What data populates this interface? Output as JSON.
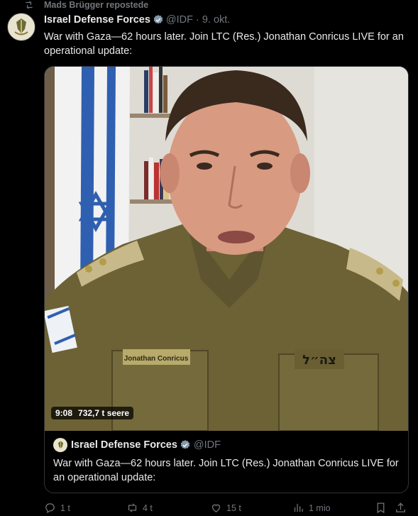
{
  "repost_header": {
    "icon": "repost-icon",
    "text": "Mads Brügger repostede"
  },
  "tweet": {
    "author_name": "Israel Defense Forces",
    "handle": "@IDF",
    "separator": "·",
    "date": "9. okt.",
    "verified_icon": "verified-badge-icon",
    "text": "War with Gaza—62 hours later. Join LTC (Res.) Jonathan Conricus LIVE for an operational update:"
  },
  "video": {
    "duration": "9:08",
    "views": "732,7 t seere",
    "name_tape": "Jonathan Conricus",
    "unit_tape": "צה״ל"
  },
  "quoted_tweet": {
    "author_name": "Israel Defense Forces",
    "handle": "@IDF",
    "text": "War with Gaza—62 hours later. Join LTC (Res.) Jonathan Conricus LIVE for an operational update:"
  },
  "actions": {
    "replies": "1 t",
    "reposts": "4 t",
    "likes": "15 t",
    "views": "1 mio"
  },
  "colors": {
    "background": "#000000",
    "text": "#e7e9ea",
    "muted": "#71767b",
    "verified": "#829aab",
    "border": "#2f3336"
  }
}
